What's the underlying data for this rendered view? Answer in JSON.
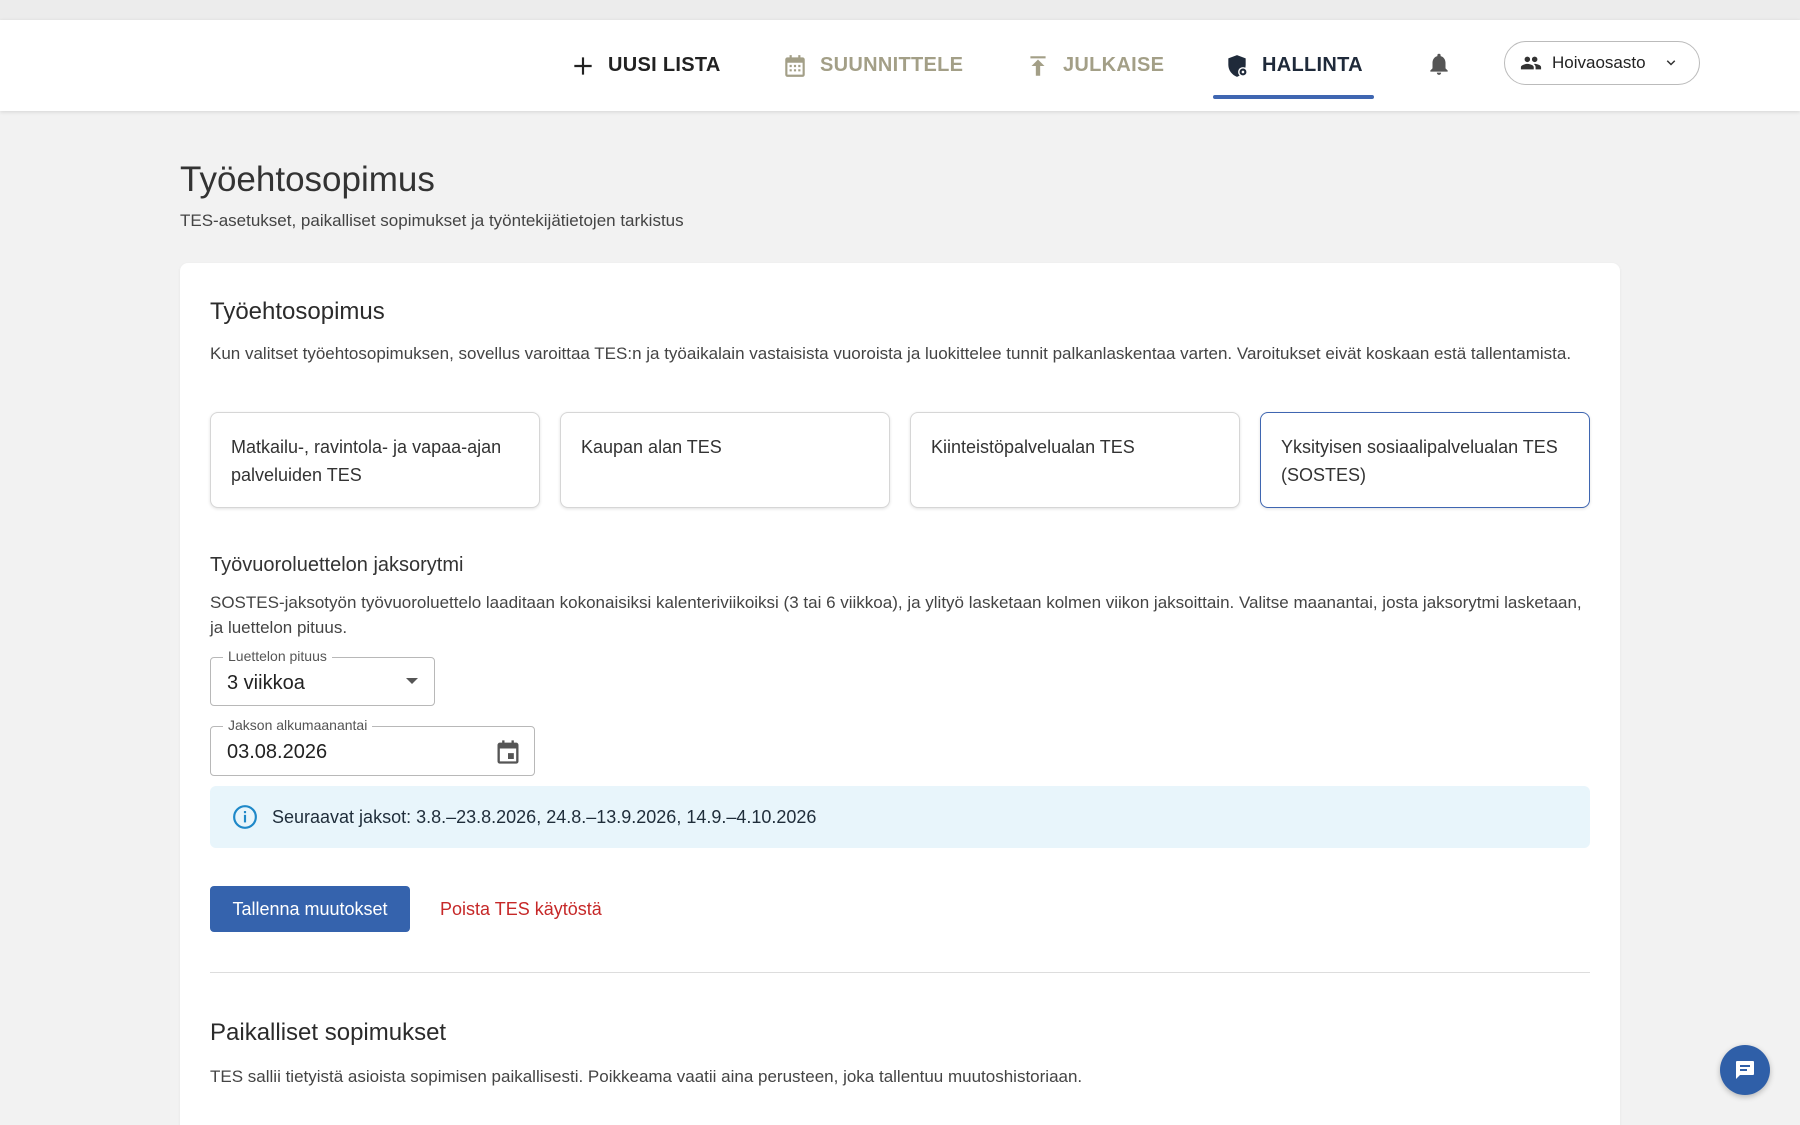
{
  "nav": {
    "new_list": "UUSI LISTA",
    "plan": "SUUNNITTELE",
    "publish": "JULKAISE",
    "admin": "HALLINTA",
    "department": "Hoivaosasto"
  },
  "header": {
    "title": "Työehtosopimus",
    "subtitle": "TES-asetukset, paikalliset sopimukset ja työntekijätietojen tarkistus"
  },
  "tes_section": {
    "title": "Työehtosopimus",
    "description": "Kun valitset työehtosopimuksen, sovellus varoittaa TES:n ja työaikalain vastaisista vuoroista ja luokittelee tunnit palkanlaskentaa varten. Varoitukset eivät koskaan estä tallentamista.",
    "options": [
      {
        "label": "Matkailu-, ravintola- ja vapaa-ajan palveluiden TES",
        "selected": false
      },
      {
        "label": "Kaupan alan TES",
        "selected": false
      },
      {
        "label": "Kiinteistöpalvelualan TES",
        "selected": false
      },
      {
        "label": "Yksityisen sosiaalipalvelualan TES (SOSTES)",
        "selected": true
      }
    ]
  },
  "period_section": {
    "title": "Työvuoroluettelon jaksorytmi",
    "description": "SOSTES-jaksotyön työvuoroluettelo laaditaan kokonaisiksi kalenteriviikoiksi (3 tai 6 viikkoa), ja ylityö lasketaan kolmen viikon jaksoittain. Valitse maanantai, josta jaksorytmi lasketaan, ja luettelon pituus.",
    "length_label": "Luettelon pituus",
    "length_value": "3 viikkoa",
    "start_label": "Jakson alkumaanantai",
    "start_value": "03.08.2026",
    "info": "Seuraavat jaksot: 3.8.–23.8.2026, 24.8.–13.9.2026, 14.9.–4.10.2026"
  },
  "actions": {
    "save": "Tallenna muutokset",
    "remove": "Poista TES käytöstä"
  },
  "local_section": {
    "title": "Paikalliset sopimukset",
    "description": "TES sallii tietyistä asioista sopimisen paikallisesti. Poikkeama vaatii aina perusteen, joka tallentuu muutoshistoriaan."
  },
  "colors": {
    "accent": "#3f66b1",
    "inactive_nav": "#a39f87",
    "danger": "#c62828",
    "info_bg": "#e8f5fb"
  }
}
